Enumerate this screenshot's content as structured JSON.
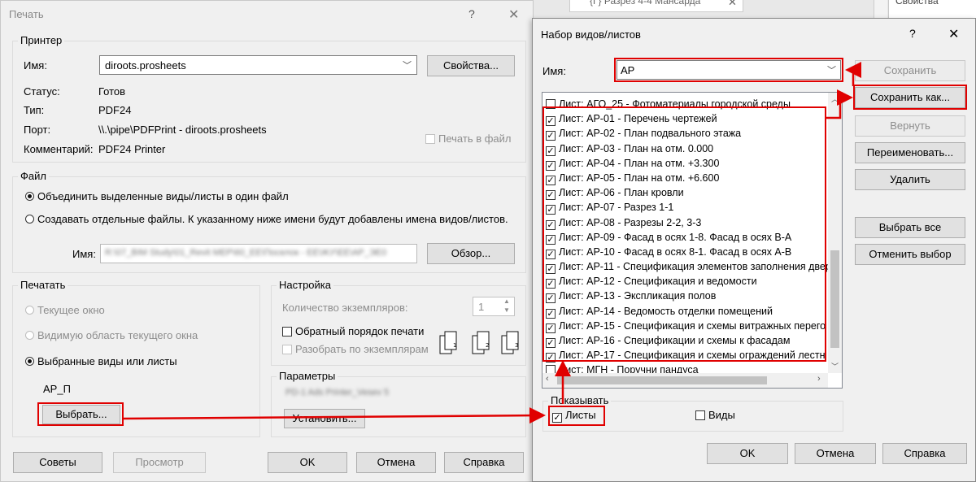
{
  "print": {
    "title": "Печать",
    "help_icon": "?",
    "close_icon": "✕",
    "printer_group": "Принтер",
    "name_label": "Имя:",
    "printer_name": "diroots.prosheets",
    "properties_button": "Свойства...",
    "status_label": "Статус:",
    "status_value": "Готов",
    "type_label": "Тип:",
    "type_value": "PDF24",
    "port_label": "Порт:",
    "port_value": "\\\\.\\pipe\\PDFPrint - diroots.prosheets",
    "comment_label": "Комментарий:",
    "comment_value": "PDF24 Printer",
    "print_to_file": "Печать в файл",
    "file_group": "Файл",
    "combine_option": "Объединить выделенные виды/листы в один файл",
    "separate_option": "Создавать отдельные файлы. К указанному ниже имени будут добавлены имена видов/листов.",
    "file_name_label": "Имя:",
    "file_name_value": "R:\\07_BIM Study\\01_Revit MEP\\60_ЕЕ\\Поселок - ЕЕ\\ЖУ\\ЕЕ\\АР_ЭЕ0",
    "browse_button": "Обзор...",
    "print_group": "Печатать",
    "current_window": "Текущее окно",
    "visible_area": "Видимую область текущего окна",
    "selected_views": "Выбранные виды или листы",
    "selection_name": "АР_П",
    "select_button": "Выбрать...",
    "settings_group": "Настройка",
    "copies_label": "Количество экземпляров:",
    "copies_value": "1",
    "reverse_order": "Обратный порядок печати",
    "collate": "Разобрать по экземплярам",
    "params_group": "Параметры",
    "params_value": "PD-1 Ads Printer_Vesev 5",
    "setup_button": "Установить...",
    "tips_button": "Советы",
    "preview_button": "Просмотр",
    "ok_button": "OK",
    "cancel_button": "Отмена",
    "help_button": "Справка"
  },
  "background": {
    "tab_title": "{Г} Разрез 4-4 Мансарда",
    "properties_panel": "Свойства"
  },
  "viewset": {
    "title": "Набор видов/листов",
    "help_icon": "?",
    "close_icon": "✕",
    "name_label": "Имя:",
    "name_value": "АР",
    "save_button": "Сохранить",
    "save_as_button": "Сохранить как...",
    "revert_button": "Вернуть",
    "rename_button": "Переименовать...",
    "delete_button": "Удалить",
    "select_all_button": "Выбрать все",
    "deselect_button": "Отменить выбор",
    "show_group": "Показывать",
    "sheets_option": "Листы",
    "views_option": "Виды",
    "ok_button": "OK",
    "cancel_button": "Отмена",
    "help_button": "Справка",
    "items": [
      {
        "label": "Лист: АГО_25 - Фотоматериалы городской среды",
        "checked": false
      },
      {
        "label": "Лист: АР-01 - Перечень чертежей",
        "checked": true
      },
      {
        "label": "Лист: АР-02 - План подвального этажа",
        "checked": true
      },
      {
        "label": "Лист: АР-03 - План на отм. 0.000",
        "checked": true
      },
      {
        "label": "Лист: АР-04 - План на отм. +3.300",
        "checked": true
      },
      {
        "label": "Лист: АР-05 - План на отм. +6.600",
        "checked": true
      },
      {
        "label": "Лист: АР-06 - План кровли",
        "checked": true
      },
      {
        "label": "Лист: АР-07 - Разрез 1-1",
        "checked": true
      },
      {
        "label": "Лист: АР-08 - Разрезы 2-2, 3-3",
        "checked": true
      },
      {
        "label": "Лист: АР-09 - Фасад в осях 1-8. Фасад в осях В-А",
        "checked": true
      },
      {
        "label": "Лист: АР-10 - Фасад в осях 8-1. Фасад в осях А-В",
        "checked": true
      },
      {
        "label": "Лист: АР-11 - Спецификация элементов заполнения двер",
        "checked": true
      },
      {
        "label": "Лист: АР-12 - Спецификация и ведомости",
        "checked": true
      },
      {
        "label": "Лист: АР-13 - Экспликация полов",
        "checked": true
      },
      {
        "label": "Лист: АР-14 - Ведомость отделки помещений",
        "checked": true
      },
      {
        "label": "Лист: АР-15 - Спецификация и схемы витражных перего",
        "checked": true
      },
      {
        "label": "Лист: АР-16 - Спецификации и схемы к фасадам",
        "checked": true
      },
      {
        "label": "Лист: АР-17 - Спецификация и схемы ограждений лестн",
        "checked": true
      },
      {
        "label": "Лист: МГН - Поручни пандуса",
        "checked": false
      }
    ]
  }
}
